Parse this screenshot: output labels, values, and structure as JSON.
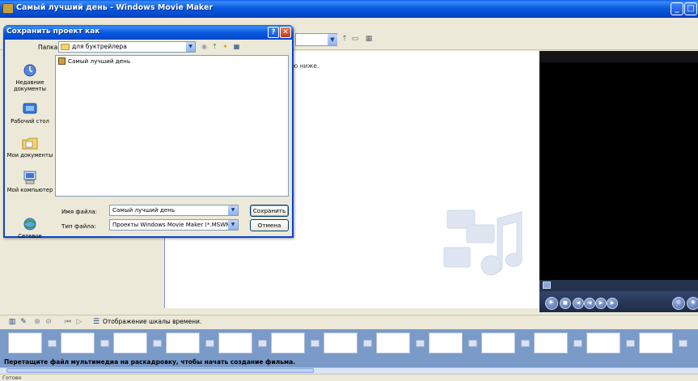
{
  "app": {
    "title": "Самый лучший день - Windows Movie Maker"
  },
  "contents": {
    "hint": "ю ниже."
  },
  "storyboard": {
    "timeline_label": "Отображение шкалы времени.",
    "hint": "Перетащите файл мультимедиа на раскадровку, чтобы начать создание фильма."
  },
  "status": {
    "text": "Готово"
  },
  "dialog": {
    "title": "Сохранить проект как",
    "folder_label": "Папка:",
    "folder_value": "для буктрейлера",
    "places": [
      {
        "label": "Недавние документы",
        "icon": "recent-documents-icon"
      },
      {
        "label": "Рабочий стол",
        "icon": "desktop-icon"
      },
      {
        "label": "Мои документы",
        "icon": "my-documents-icon"
      },
      {
        "label": "Мой компьютер",
        "icon": "my-computer-icon"
      },
      {
        "label": "Сетевое",
        "icon": "network-icon"
      }
    ],
    "files": [
      {
        "name": "Самый лучший день",
        "icon": "movie-project-icon"
      }
    ],
    "filename_label": "Имя файла:",
    "filename_value": "Самый лучший день",
    "filetype_label": "Тип файла:",
    "filetype_value": "Проекты Windows Movie Maker (*.MSWMM)",
    "save_label": "Сохранить",
    "cancel_label": "Отмена"
  },
  "colors": {
    "titlebar": "#0a5be0",
    "storyboard": "#7a9ac8",
    "preview": "#000000"
  }
}
